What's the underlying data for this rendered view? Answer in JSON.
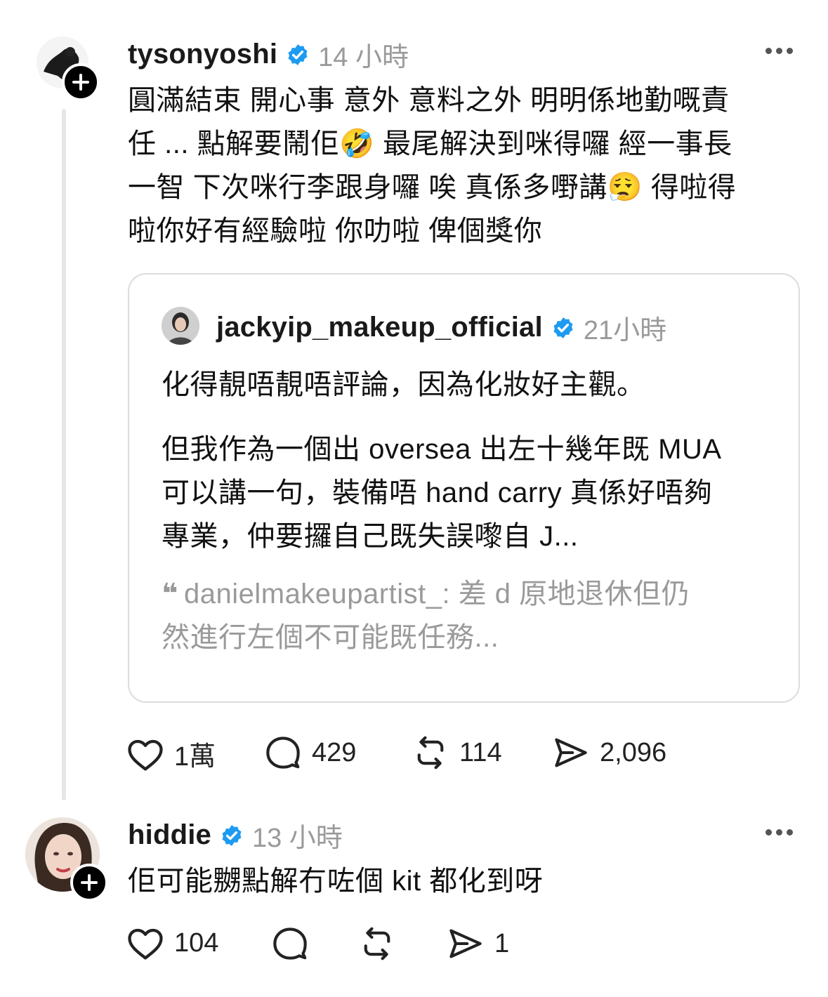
{
  "post": {
    "username": "tysonyoshi",
    "time": "14 小時",
    "lines": [
      "圓滿結束 開心事 意外 意料之外 明明係地勤嘅責",
      "任 ... 點解要鬧佢",
      "最尾解決到咪得囉 經一事長",
      "一智 下次咪行李跟身囉 唉 真係多嘢講",
      "得啦得",
      "啦你好有經驗啦 你叻啦 俾個獎你"
    ],
    "emoji_1": "🤣",
    "emoji_2": "😮‍💨",
    "quote": {
      "username": "jackyip_makeup_official",
      "time": "21小時",
      "line1": "化得靚唔靚唔評論，因為化妝好主觀。",
      "line2": "但我作為一個出 oversea 出左十幾年既 MUA",
      "line3": "可以講一句，裝備唔 hand carry 真係好唔夠",
      "line4": "專業，仲要攞自己既失誤嚟自 J...",
      "quoted_quote_mark": "❝",
      "quoted_line1": "danielmakeupartist_: 差 d 原地退休但仍",
      "quoted_line2": "然進行左個不可能既任務..."
    },
    "actions": {
      "likes": "1萬",
      "replies": "429",
      "reposts": "114",
      "shares": "2,096"
    }
  },
  "reply": {
    "username": "hiddie",
    "time": "13 小時",
    "text": "佢可能嬲點解冇咗個 kit 都化到呀",
    "actions": {
      "likes": "104",
      "replies": "",
      "reposts": "",
      "shares": "1"
    }
  },
  "colors": {
    "verified": "#1d9bf0",
    "muted": "#9a9a9a",
    "border": "#dcdcdc"
  }
}
